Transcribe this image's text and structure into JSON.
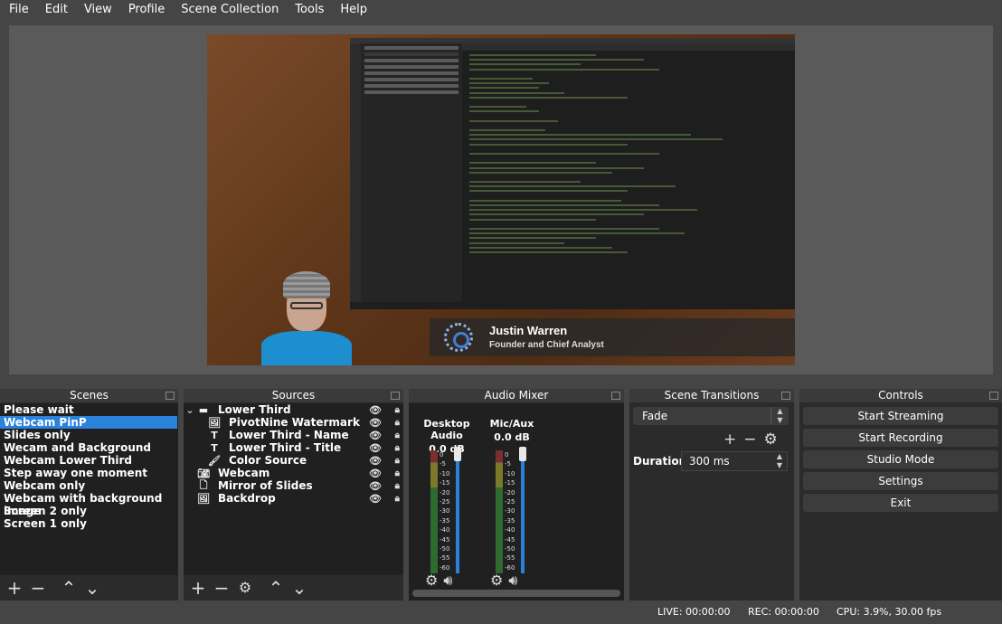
{
  "menu": [
    "File",
    "Edit",
    "View",
    "Profile",
    "Scene Collection",
    "Tools",
    "Help"
  ],
  "preview": {
    "lower_third_name": "Justin Warren",
    "lower_third_title": "Founder and Chief Analyst"
  },
  "docks": {
    "scenes_title": "Scenes",
    "sources_title": "Sources",
    "mixer_title": "Audio Mixer",
    "transitions_title": "Scene Transitions",
    "controls_title": "Controls"
  },
  "scenes": {
    "items": [
      "Please wait",
      "Webcam PinP",
      "Slides only",
      "Wecam and Background",
      "Webcam Lower Third",
      "Step away one moment",
      "Webcam only",
      "Webcam with background image",
      "Screen 2 only",
      "Screen 1 only"
    ],
    "selected_index": 1
  },
  "sources": {
    "items": [
      {
        "label": "Lower Third",
        "icon": "group-icon"
      },
      {
        "label": "PivotNine Watermark",
        "icon": "image-icon"
      },
      {
        "label": "Lower Third - Name",
        "icon": "text-icon"
      },
      {
        "label": "Lower Third - Title",
        "icon": "text-icon"
      },
      {
        "label": "Color Source",
        "icon": "color-brush-icon"
      },
      {
        "label": "Webcam",
        "icon": "camera-icon"
      },
      {
        "label": "Mirror of Slides",
        "icon": "window-icon"
      },
      {
        "label": "Backdrop",
        "icon": "image-icon"
      }
    ]
  },
  "mixer": {
    "channels": [
      {
        "name": "Desktop Audio",
        "db": "0.0 dB"
      },
      {
        "name": "Mic/Aux",
        "db": "0.0 dB"
      }
    ],
    "scale": [
      "0",
      "-5",
      "-10",
      "-15",
      "-20",
      "-25",
      "-30",
      "-35",
      "-40",
      "-45",
      "-50",
      "-55",
      "-60"
    ]
  },
  "transitions": {
    "selected": "Fade",
    "duration_label": "Duration",
    "duration_value": "300 ms"
  },
  "controls": {
    "start_streaming": "Start Streaming",
    "start_recording": "Start Recording",
    "studio_mode": "Studio Mode",
    "settings": "Settings",
    "exit": "Exit"
  },
  "status": {
    "live": "LIVE: 00:00:00",
    "rec": "REC: 00:00:00",
    "cpu": "CPU: 3.9%, 30.00 fps"
  },
  "colors": {
    "selection": "#2a82da",
    "background": "#454545",
    "panel": "#202020"
  }
}
